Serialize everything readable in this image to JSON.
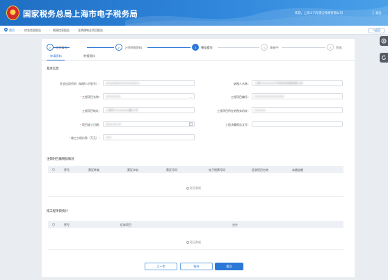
{
  "header": {
    "title": "国家税务总局上海市电子税务局",
    "welcome": "欢迎，上海Ｘ汽车安全系统有限公司",
    "exit_label": "退出"
  },
  "breadcrumb": {
    "items": [
      "首页",
      "综合信息报告",
      "税源信息报告",
      "注销建筑业项目报告"
    ]
  },
  "back_label": "返回",
  "steps": [
    {
      "num": "✓",
      "label": "信息填写",
      "state": "done"
    },
    {
      "num": "✓",
      "label": "上传附报资料",
      "state": "done"
    },
    {
      "num": "3",
      "label": "预览提交",
      "state": "active"
    },
    {
      "num": "4",
      "label": "审核中",
      "state": "todo"
    },
    {
      "num": "5",
      "label": "完成",
      "state": "todo"
    }
  ],
  "tabs": [
    "申请资料",
    "附报资料"
  ],
  "basic": {
    "section_title": "基本信息",
    "fields": {
      "credit_code": {
        "label": "社会信用代码（纳税人识别号）：",
        "value": "91310000XXXXXXXX0373",
        "required": false
      },
      "taxpayer_name": {
        "label": "纳税人名称：",
        "value": "上海XXXXXXXX汽车安全系统有限公司",
        "required": false
      },
      "project_name": {
        "label": "工程项目名称：",
        "value": "XXXXXXXX",
        "required": true
      },
      "project_code": {
        "label": "工程项目编号：",
        "value": "XXXXXXXXXXXXXXXX",
        "required": false
      },
      "project_address": {
        "label": "工程项目地址：",
        "value": "上海市XXXXXXXX路XX号",
        "required": false
      },
      "project_tax_org": {
        "label": "工程项目所在地税务机关：",
        "value": "XXXXXX",
        "required": false
      },
      "completion_date": {
        "label": "项目竣工日期：",
        "value": "2019-XX-XX",
        "required": true
      },
      "settlement_doc": {
        "label": "工程决算报告文号：",
        "value": "",
        "required": false
      },
      "settlement_amount": {
        "label": "竣工工程价款（万元）：",
        "value": "XXX",
        "required": true
      }
    }
  },
  "invoice_section": {
    "title": "注销时已缴税款情况",
    "columns": [
      "序号",
      "票证种类",
      "票证字轨",
      "票证号码",
      "电子税票号码",
      "征收项目名称",
      "实缴金额"
    ],
    "empty_text": "暂无数据"
  },
  "subcontract_section": {
    "title": "按工程项目统计",
    "columns": [
      "序号",
      "征收项目",
      "合计"
    ],
    "empty_text": "暂无数据"
  },
  "buttons": {
    "prev": "上一步",
    "save": "保存",
    "submit": "提交"
  },
  "colors": {
    "primary": "#2b78d8",
    "header_start": "#1f6fc4",
    "header_end": "#4aa0e8",
    "required": "#ee2233"
  }
}
